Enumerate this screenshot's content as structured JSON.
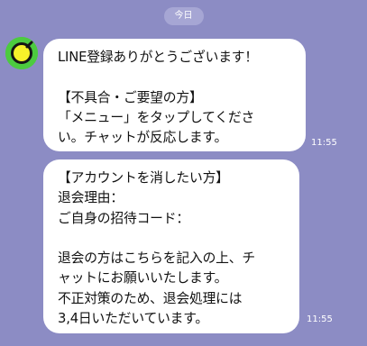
{
  "date_label": "今日",
  "colors": {
    "chat_background": "#8c8cc4",
    "bubble": "#ffffff",
    "avatar_green": "#4ccb3f"
  },
  "avatar": {
    "icon": "green-yellow-ring-icon"
  },
  "messages": [
    {
      "lines": [
        "LINE登録ありがとうございます！",
        "",
        "【不具合・ご要望の方】",
        "「メニュー」をタップしてくださ",
        "い。チャットが反応します。"
      ],
      "time": "11:55"
    },
    {
      "lines": [
        "【アカウントを消したい方】",
        "退会理由：",
        "ご自身の招待コード：",
        "",
        "退会の方はこちらを記入の上、チ",
        "ャットにお願いいたします。",
        "不正対策のため、退会処理には",
        "3,4日いただいています。"
      ],
      "time": "11:55"
    }
  ]
}
